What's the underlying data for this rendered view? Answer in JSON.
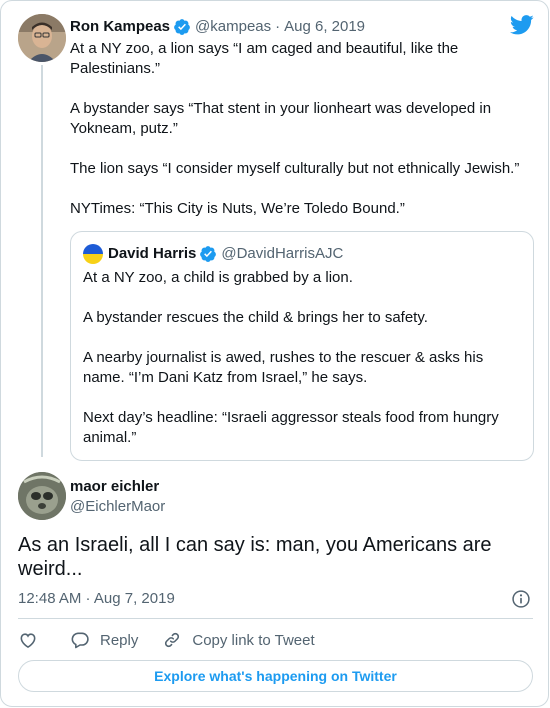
{
  "parent": {
    "name": "Ron Kampeas",
    "handle": "@kampeas",
    "separator": "·",
    "date": "Aug 6, 2019",
    "paragraphs": [
      "At a NY zoo, a lion says “I am caged and beautiful, like the Palestinians.”",
      "A bystander says “That stent in your lionheart was developed in Yokneam, putz.”",
      "The lion says “I consider myself culturally but not ethnically Jewish.”",
      "NYTimes: “This City is Nuts, We’re Toledo Bound.”"
    ]
  },
  "quoted": {
    "name": "David Harris",
    "handle": "@DavidHarrisAJC",
    "paragraphs": [
      "At a NY zoo, a child is grabbed by a lion.",
      "A bystander rescues the child & brings her to safety.",
      "A nearby journalist is awed, rushes to the rescuer & asks his name. “I’m Dani Katz from Israel,” he says.",
      "Next day’s headline: “Israeli aggressor steals food from hungry animal.”"
    ]
  },
  "reply": {
    "name": "maor eichler",
    "handle": "@EichlerMaor",
    "text": "As an Israeli, all I can say is: man, you Americans are weird...",
    "time": "12:48 AM · Aug 7, 2019"
  },
  "actions": {
    "reply_label": "Reply",
    "copy_label": "Copy link to Tweet"
  },
  "explore_label": "Explore what's happening on Twitter",
  "icons": {
    "brand": "twitter-bird-icon",
    "verified": "verified-badge-icon",
    "info": "info-icon",
    "like": "heart-icon",
    "reply": "reply-bubble-icon",
    "copy": "link-icon"
  },
  "colors": {
    "accent": "#1d9bf0",
    "text": "#0f1419",
    "muted": "#536471",
    "border": "#cfd9de"
  }
}
